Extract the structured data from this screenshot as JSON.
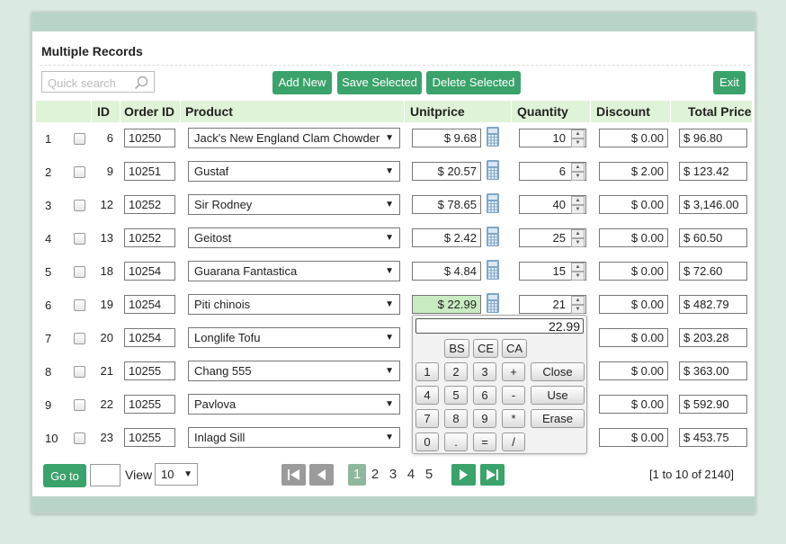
{
  "title": "Multiple Records",
  "search": {
    "placeholder": "Quick search"
  },
  "toolbar": {
    "add_new": "Add New",
    "save_selected": "Save Selected",
    "delete_selected": "Delete Selected",
    "exit": "Exit"
  },
  "columns": {
    "id": "ID",
    "order_id": "Order ID",
    "product": "Product",
    "unitprice": "Unitprice",
    "quantity": "Quantity",
    "discount": "Discount",
    "total_price": "Total Price"
  },
  "rows": [
    {
      "num": "1",
      "id": "6",
      "order_id": "10250",
      "product": "Jack's New England Clam Chowder",
      "unitprice": "$ 9.68",
      "quantity": "10",
      "discount": "$ 0.00",
      "total": "$ 96.80"
    },
    {
      "num": "2",
      "id": "9",
      "order_id": "10251",
      "product": "Gustaf",
      "unitprice": "$ 20.57",
      "quantity": "6",
      "discount": "$ 2.00",
      "total": "$ 123.42"
    },
    {
      "num": "3",
      "id": "12",
      "order_id": "10252",
      "product": "Sir Rodney",
      "unitprice": "$ 78.65",
      "quantity": "40",
      "discount": "$ 0.00",
      "total": "$ 3,146.00"
    },
    {
      "num": "4",
      "id": "13",
      "order_id": "10252",
      "product": "Geitost",
      "unitprice": "$ 2.42",
      "quantity": "25",
      "discount": "$ 0.00",
      "total": "$ 60.50"
    },
    {
      "num": "5",
      "id": "18",
      "order_id": "10254",
      "product": "Guarana Fantastica",
      "unitprice": "$ 4.84",
      "quantity": "15",
      "discount": "$ 0.00",
      "total": "$ 72.60"
    },
    {
      "num": "6",
      "id": "19",
      "order_id": "10254",
      "product": "Piti chinois",
      "unitprice": "$ 22.99",
      "quantity": "21",
      "discount": "$ 0.00",
      "total": "$ 482.79"
    },
    {
      "num": "7",
      "id": "20",
      "order_id": "10254",
      "product": "Longlife Tofu",
      "unitprice": "",
      "quantity": "",
      "discount": "$ 0.00",
      "total": "$ 203.28"
    },
    {
      "num": "8",
      "id": "21",
      "order_id": "10255",
      "product": "Chang 555",
      "unitprice": "",
      "quantity": "",
      "discount": "$ 0.00",
      "total": "$ 363.00"
    },
    {
      "num": "9",
      "id": "22",
      "order_id": "10255",
      "product": "Pavlova",
      "unitprice": "",
      "quantity": "",
      "discount": "$ 0.00",
      "total": "$ 592.90"
    },
    {
      "num": "10",
      "id": "23",
      "order_id": "10255",
      "product": "Inlagd Sill",
      "unitprice": "",
      "quantity": "",
      "discount": "$ 0.00",
      "total": "$ 453.75"
    }
  ],
  "active_row": 5,
  "calculator": {
    "display": "22.99",
    "keys": {
      "bs": "BS",
      "ce": "CE",
      "ca": "CA",
      "k1": "1",
      "k2": "2",
      "k3": "3",
      "plus": "+",
      "close": "Close",
      "k4": "4",
      "k5": "5",
      "k6": "6",
      "minus": "-",
      "use": "Use",
      "k7": "7",
      "k8": "8",
      "k9": "9",
      "mul": "*",
      "erase": "Erase",
      "k0": "0",
      "dot": ".",
      "eq": "=",
      "div": "/"
    }
  },
  "footer": {
    "goto_label": "Go to",
    "view_label": "View",
    "view_value": "10",
    "pages": [
      "1",
      "2",
      "3",
      "4",
      "5"
    ],
    "current_page": "1",
    "info": "[1 to 10 of 2140]"
  },
  "colors": {
    "accent": "#3aa36b",
    "header_bg": "#dff3d9",
    "frame_bar": "#b8d4c6",
    "active_field": "#c9ebc1"
  },
  "icons": {
    "search": "magnifier-icon",
    "calculator": "calculator-icon",
    "first": "first-page-icon",
    "prev": "prev-page-icon",
    "next": "next-page-icon",
    "last": "last-page-icon"
  }
}
